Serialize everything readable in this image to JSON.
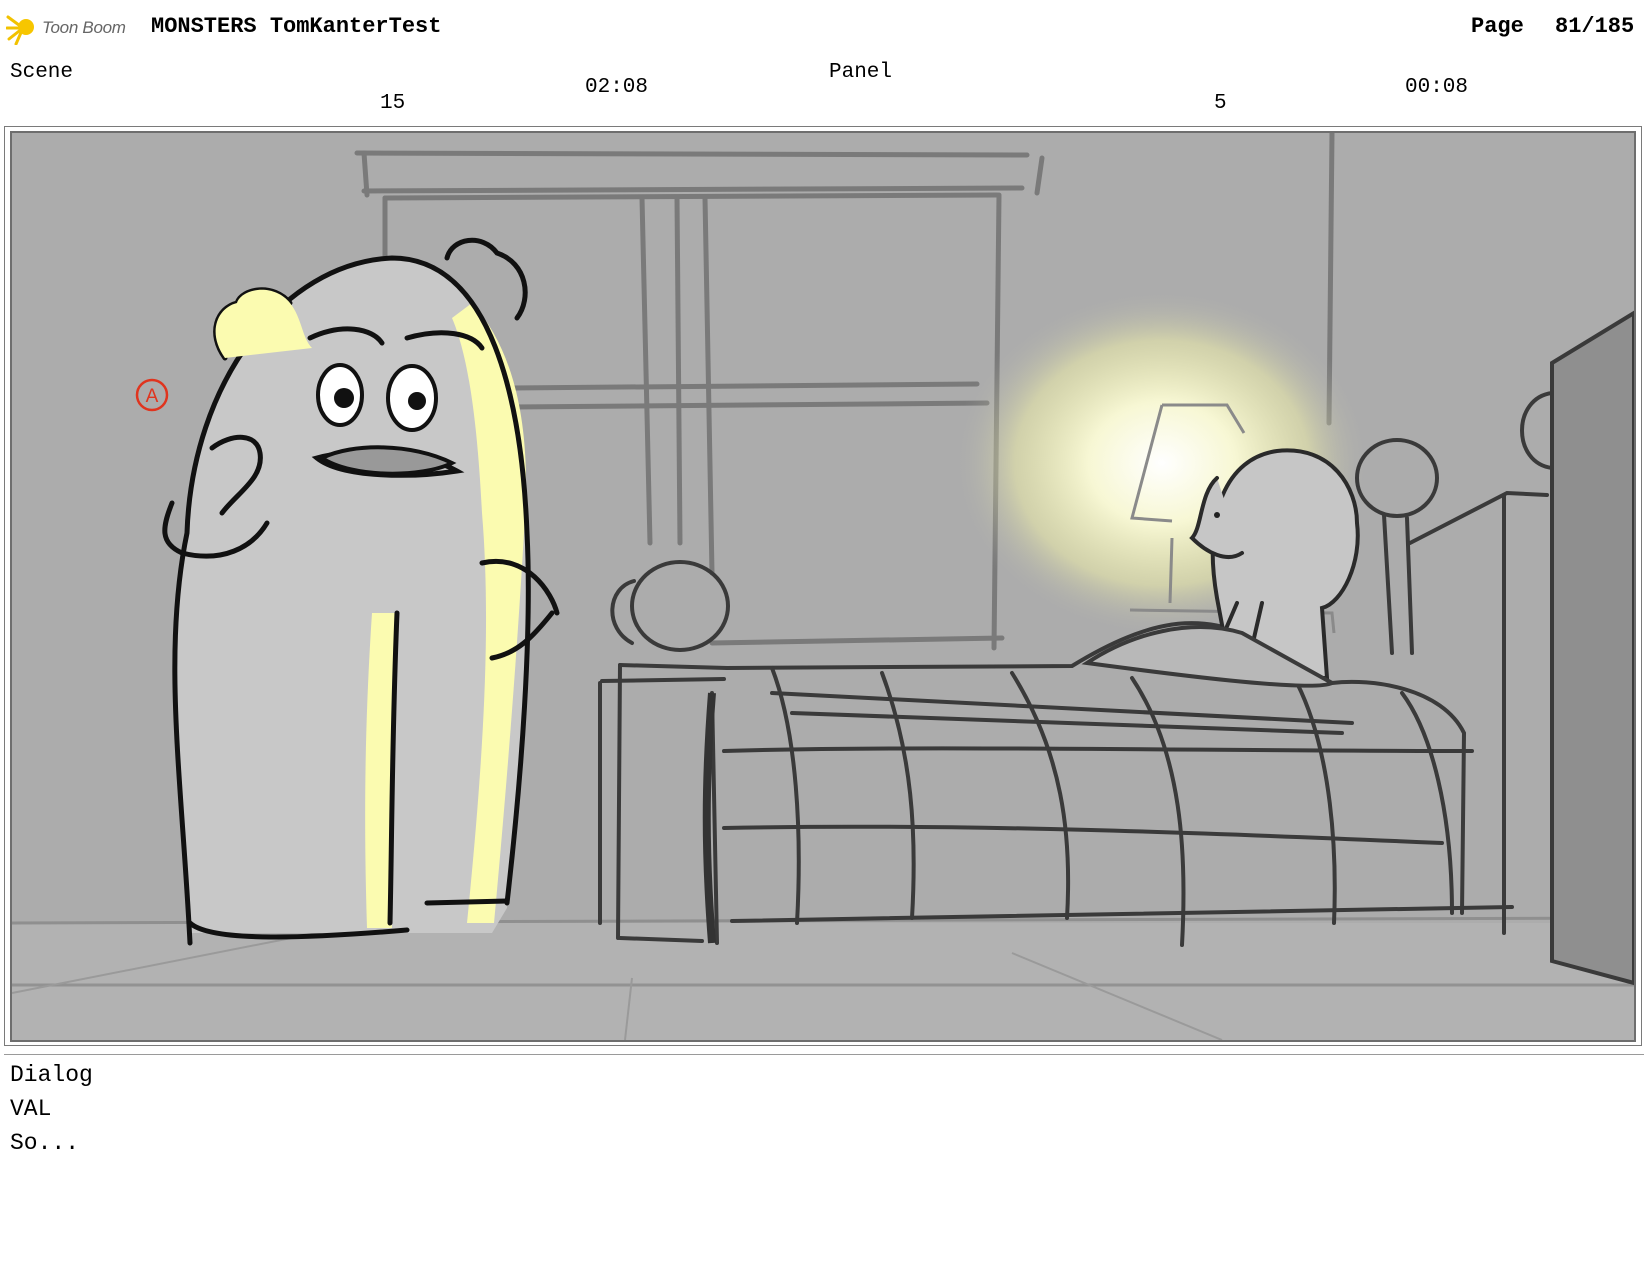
{
  "header": {
    "logo_text": "Toon Boom",
    "project_title": "MONSTERS TomKanterTest",
    "page_label": "Page",
    "page_number": "81/185"
  },
  "scene": {
    "label": "Scene",
    "number": "15",
    "duration": "02:08"
  },
  "panel": {
    "label": "Panel",
    "number": "5",
    "duration": "00:08"
  },
  "annotation_mark": "A",
  "dialog": {
    "label": "Dialog",
    "character": "VAL",
    "line": "So..."
  }
}
